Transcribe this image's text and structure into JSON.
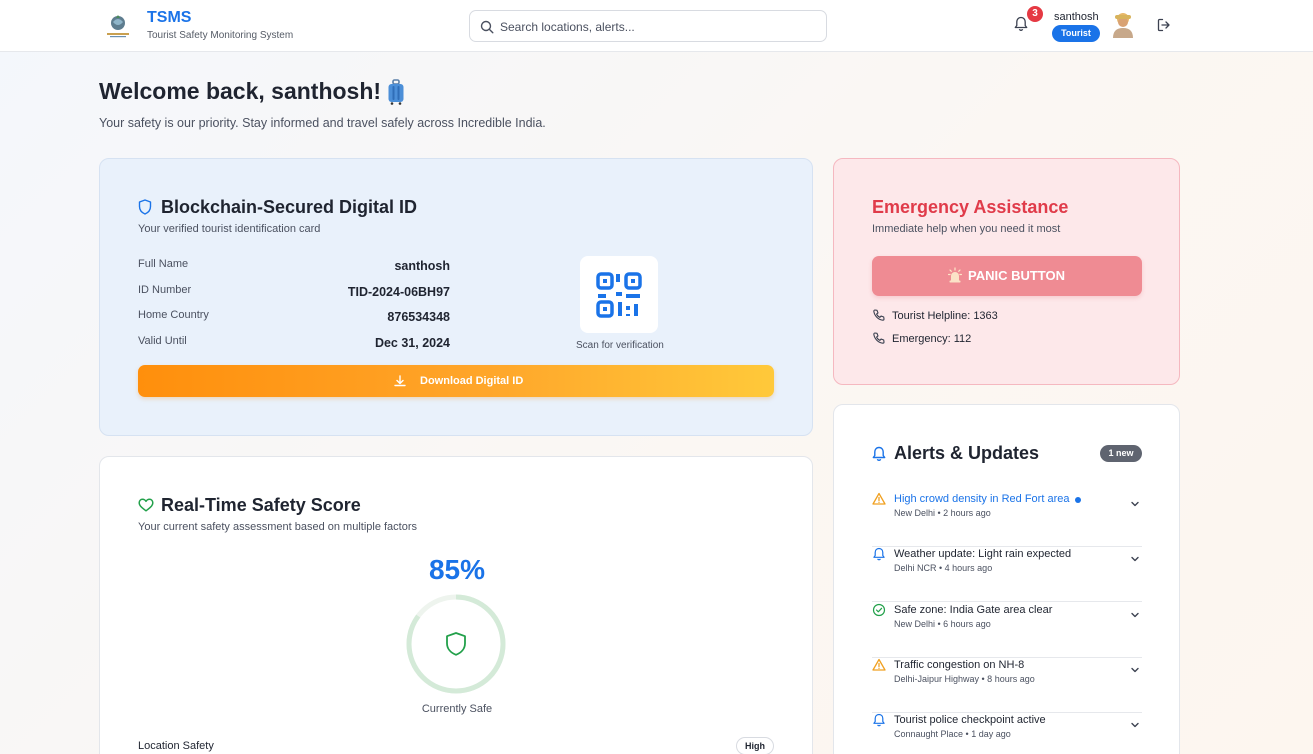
{
  "header": {
    "brand_title": "TSMS",
    "brand_subtitle": "Tourist Safety Monitoring System",
    "search_placeholder": "Search locations, alerts...",
    "notification_count": "3",
    "user_name": "santhosh",
    "user_role": "Tourist"
  },
  "welcome": {
    "title": "Welcome back, santhosh!",
    "subtitle": "Your safety is our priority. Stay informed and travel safely across Incredible India."
  },
  "digital_id": {
    "title": "Blockchain-Secured Digital ID",
    "subtitle": "Your verified tourist identification card",
    "fields": [
      {
        "label": "Full Name",
        "value": "santhosh"
      },
      {
        "label": "ID Number",
        "value": "TID-2024-06BH97"
      },
      {
        "label": "Home Country",
        "value": "876534348"
      },
      {
        "label": "Valid Until",
        "value": "Dec 31, 2024"
      }
    ],
    "qr_caption": "Scan for verification",
    "download_label": "Download Digital ID"
  },
  "safety": {
    "title": "Real-Time Safety Score",
    "subtitle": "Your current safety assessment based on multiple factors",
    "score": "85%",
    "score_fraction": 0.85,
    "status": "Currently Safe",
    "factors": [
      {
        "label": "Location Safety",
        "level": "High"
      }
    ]
  },
  "emergency": {
    "title": "Emergency Assistance",
    "subtitle": "Immediate help when you need it most",
    "panic_label": "PANIC BUTTON",
    "helpline": "Tourist Helpline: 1363",
    "emergency": "Emergency: 112"
  },
  "alerts": {
    "title": "Alerts & Updates",
    "new_badge": "1 new",
    "items": [
      {
        "title": "High crowd density in Red Fort area",
        "meta": "New Delhi • 2 hours ago",
        "icon": "warning-icon",
        "unread": true
      },
      {
        "title": "Weather update: Light rain expected",
        "meta": "Delhi NCR • 4 hours ago",
        "icon": "bell-icon",
        "unread": false
      },
      {
        "title": "Safe zone: India Gate area clear",
        "meta": "New Delhi • 6 hours ago",
        "icon": "check-circle-icon",
        "unread": false
      },
      {
        "title": "Traffic congestion on NH-8",
        "meta": "Delhi-Jaipur Highway • 8 hours ago",
        "icon": "warning-icon",
        "unread": false
      },
      {
        "title": "Tourist police checkpoint active",
        "meta": "Connaught Place • 1 day ago",
        "icon": "bell-icon",
        "unread": false
      }
    ]
  },
  "colors": {
    "primary": "#1a73e8",
    "danger": "#e03b4a",
    "warning": "#f0a020",
    "success": "#22a04a"
  }
}
